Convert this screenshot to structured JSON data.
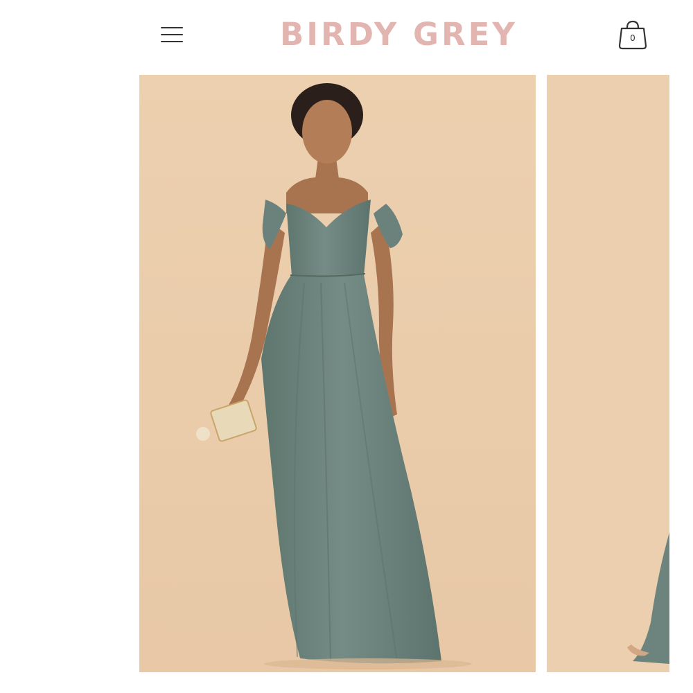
{
  "header": {
    "brand": "BIRDY GREY",
    "cart_count": "0",
    "menu_icon": "hamburger-menu-icon",
    "cart_icon": "shopping-bag-icon"
  },
  "gallery": {
    "images": [
      {
        "subject": "model-in-sage-off-shoulder-dress",
        "background_color": "#eccfae",
        "dress_color": "#6f8680"
      },
      {
        "subject": "model-partial-view",
        "background_color": "#eccfae",
        "dress_color": "#6f8680"
      }
    ]
  },
  "colors": {
    "brand": "#e3b5b0",
    "icons": "#333333",
    "page_background": "#ffffff"
  }
}
